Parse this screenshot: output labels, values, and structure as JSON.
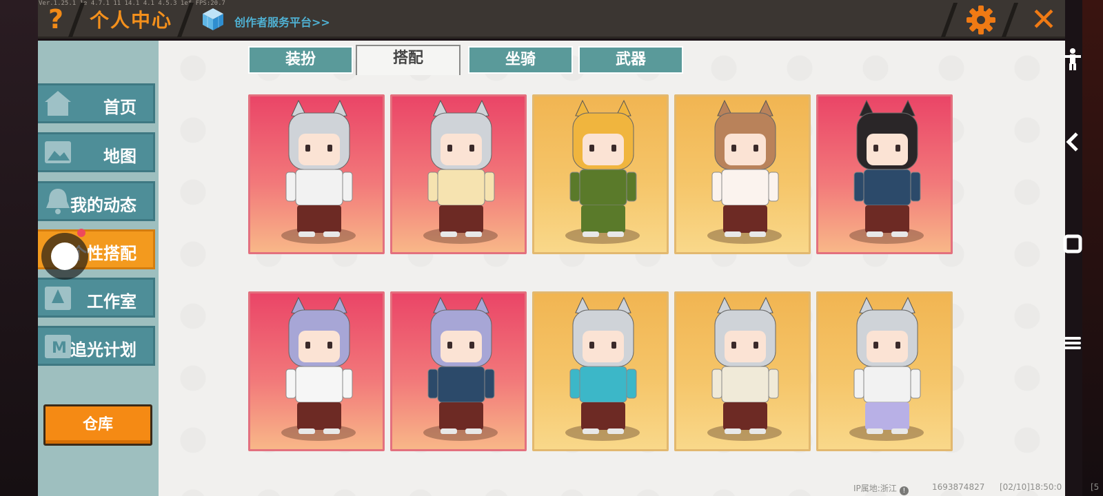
{
  "header": {
    "version": "Ver.1.25.1 1e 4.7.1 11 14.1 4.1 4.5.3 1ef FPS:20.7",
    "help_icon": "question-icon",
    "title": "个人中心",
    "creator_link": "创作者服务平台>>",
    "settings_icon": "gear-icon",
    "close_icon": "close-icon"
  },
  "sidebar": {
    "items": [
      {
        "label": "首页",
        "icon": "home-icon"
      },
      {
        "label": "地图",
        "icon": "map-icon"
      },
      {
        "label": "我的动态",
        "icon": "bell-icon"
      },
      {
        "label": "个性搭配",
        "icon": "outfit-icon",
        "active": true
      },
      {
        "label": "工作室",
        "icon": "studio-icon"
      },
      {
        "label": "追光计划",
        "icon": "light-plan-icon"
      }
    ],
    "warehouse_label": "仓库"
  },
  "tabs": [
    {
      "label": "装扮"
    },
    {
      "label": "搭配",
      "active": true
    },
    {
      "label": "坐骑"
    },
    {
      "label": "武器"
    }
  ],
  "outfits": [
    {
      "bg": "pink",
      "hair": "#cfd3d8",
      "shirt": "#f2f2f2",
      "pants": "#6d2a24"
    },
    {
      "bg": "pink",
      "hair": "#cfd3d8",
      "shirt": "#f6e3b0",
      "pants": "#6d2a24"
    },
    {
      "bg": "gold",
      "hair": "#f0b53e",
      "shirt": "#5a7a2a",
      "pants": "#5a7a2a"
    },
    {
      "bg": "gold",
      "hair": "#b9825a",
      "shirt": "#fbf3ee",
      "pants": "#6d2a24"
    },
    {
      "bg": "pink",
      "hair": "#2a2628",
      "shirt": "#2c4a6a",
      "pants": "#6d2a24"
    },
    {
      "bg": "pink",
      "hair": "#a7a6d6",
      "shirt": "#f6f6f6",
      "pants": "#6d2a24"
    },
    {
      "bg": "pink",
      "hair": "#a7a6d6",
      "shirt": "#2c4a6a",
      "pants": "#6d2a24"
    },
    {
      "bg": "gold",
      "hair": "#cfd3d8",
      "shirt": "#3cb7c8",
      "pants": "#6d2a24"
    },
    {
      "bg": "gold",
      "hair": "#cfd3d8",
      "shirt": "#f0ead8",
      "pants": "#6d2a24"
    },
    {
      "bg": "gold",
      "hair": "#cfd3d8",
      "shirt": "#f2f2f2",
      "pants": "#b8b0e6"
    }
  ],
  "footer": {
    "ip_location": "IP属地:浙江",
    "uid": "1693874827",
    "timestamp": "[02/10]18:50:0",
    "extra": "[5"
  },
  "colors": {
    "accent": "#f4901c",
    "teal": "#4e8e98",
    "link": "#4fb1d3"
  }
}
